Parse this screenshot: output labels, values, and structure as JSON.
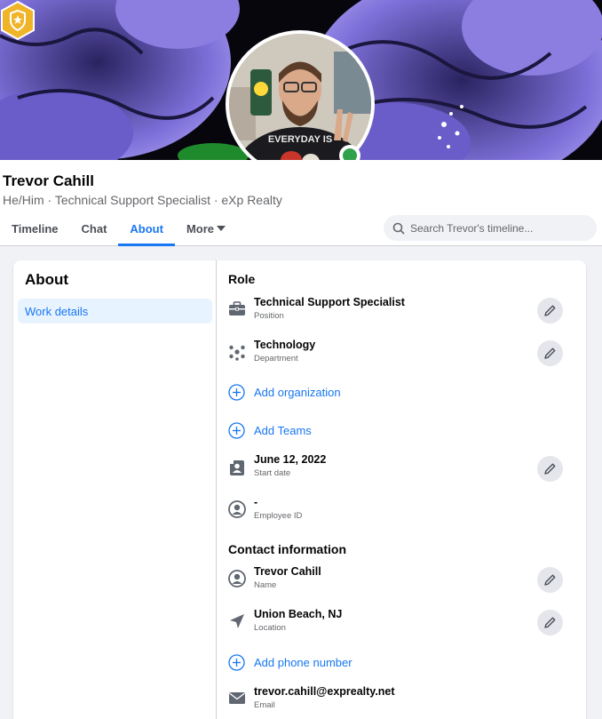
{
  "profile": {
    "name": "Trevor Cahill",
    "subtitle": "He/Him · Technical Support Specialist · eXp Realty",
    "shirt_text": "EVERYDAY IS"
  },
  "tabs": [
    {
      "label": "Timeline"
    },
    {
      "label": "Chat"
    },
    {
      "label": "About",
      "active": true
    },
    {
      "label": "More"
    }
  ],
  "search": {
    "placeholder": "Search Trevor's timeline..."
  },
  "about": {
    "title": "About",
    "nav": [
      {
        "label": "Work details",
        "selected": true
      }
    ],
    "role_title": "Role",
    "role": {
      "position": {
        "value": "Technical Support Specialist",
        "label": "Position",
        "icon": "briefcase-icon"
      },
      "department": {
        "value": "Technology",
        "label": "Department",
        "icon": "network-icon"
      },
      "add_organization": "Add organization",
      "add_teams": "Add Teams",
      "start_date": {
        "value": "June 12, 2022",
        "label": "Start date",
        "icon": "id-card-icon"
      },
      "employee_id": {
        "value": "-",
        "label": "Employee ID",
        "icon": "person-circle-icon"
      }
    },
    "contact_title": "Contact information",
    "contact": {
      "name": {
        "value": "Trevor Cahill",
        "label": "Name",
        "icon": "person-circle-icon"
      },
      "location": {
        "value": "Union Beach, NJ",
        "label": "Location",
        "icon": "location-arrow-icon"
      },
      "add_phone": "Add phone number",
      "email": {
        "value": "trevor.cahill@exprealty.net",
        "label": "Email",
        "icon": "envelope-icon"
      }
    }
  },
  "colors": {
    "accent": "#1877f2",
    "online": "#31a24c",
    "badge": "#f0b429",
    "cover_flower": "#7d6fd8"
  }
}
